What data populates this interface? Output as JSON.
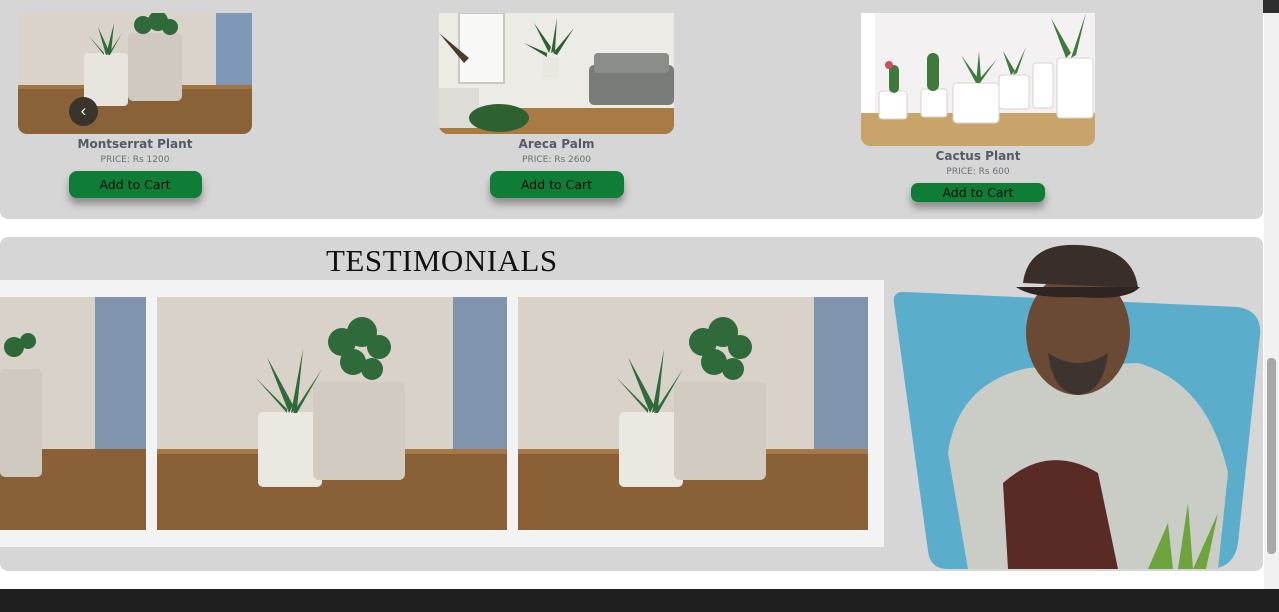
{
  "products": [
    {
      "name": "Montserrat Plant",
      "price": "PRICE: Rs 1200",
      "button": "Add to Cart"
    },
    {
      "name": "Areca Palm",
      "price": "PRICE: Rs 2600",
      "button": "Add to Cart"
    },
    {
      "name": "Cactus Plant",
      "price": "PRICE: Rs 600",
      "button": "Add to Cart"
    }
  ],
  "carousel": {
    "prev_icon": "chevron-left-icon"
  },
  "testimonials": {
    "heading": "TESTIMONIALS"
  },
  "colors": {
    "button": "#0f7d36",
    "panel": "#d6d6d6",
    "testimonial_bg": "#5aaecb"
  }
}
